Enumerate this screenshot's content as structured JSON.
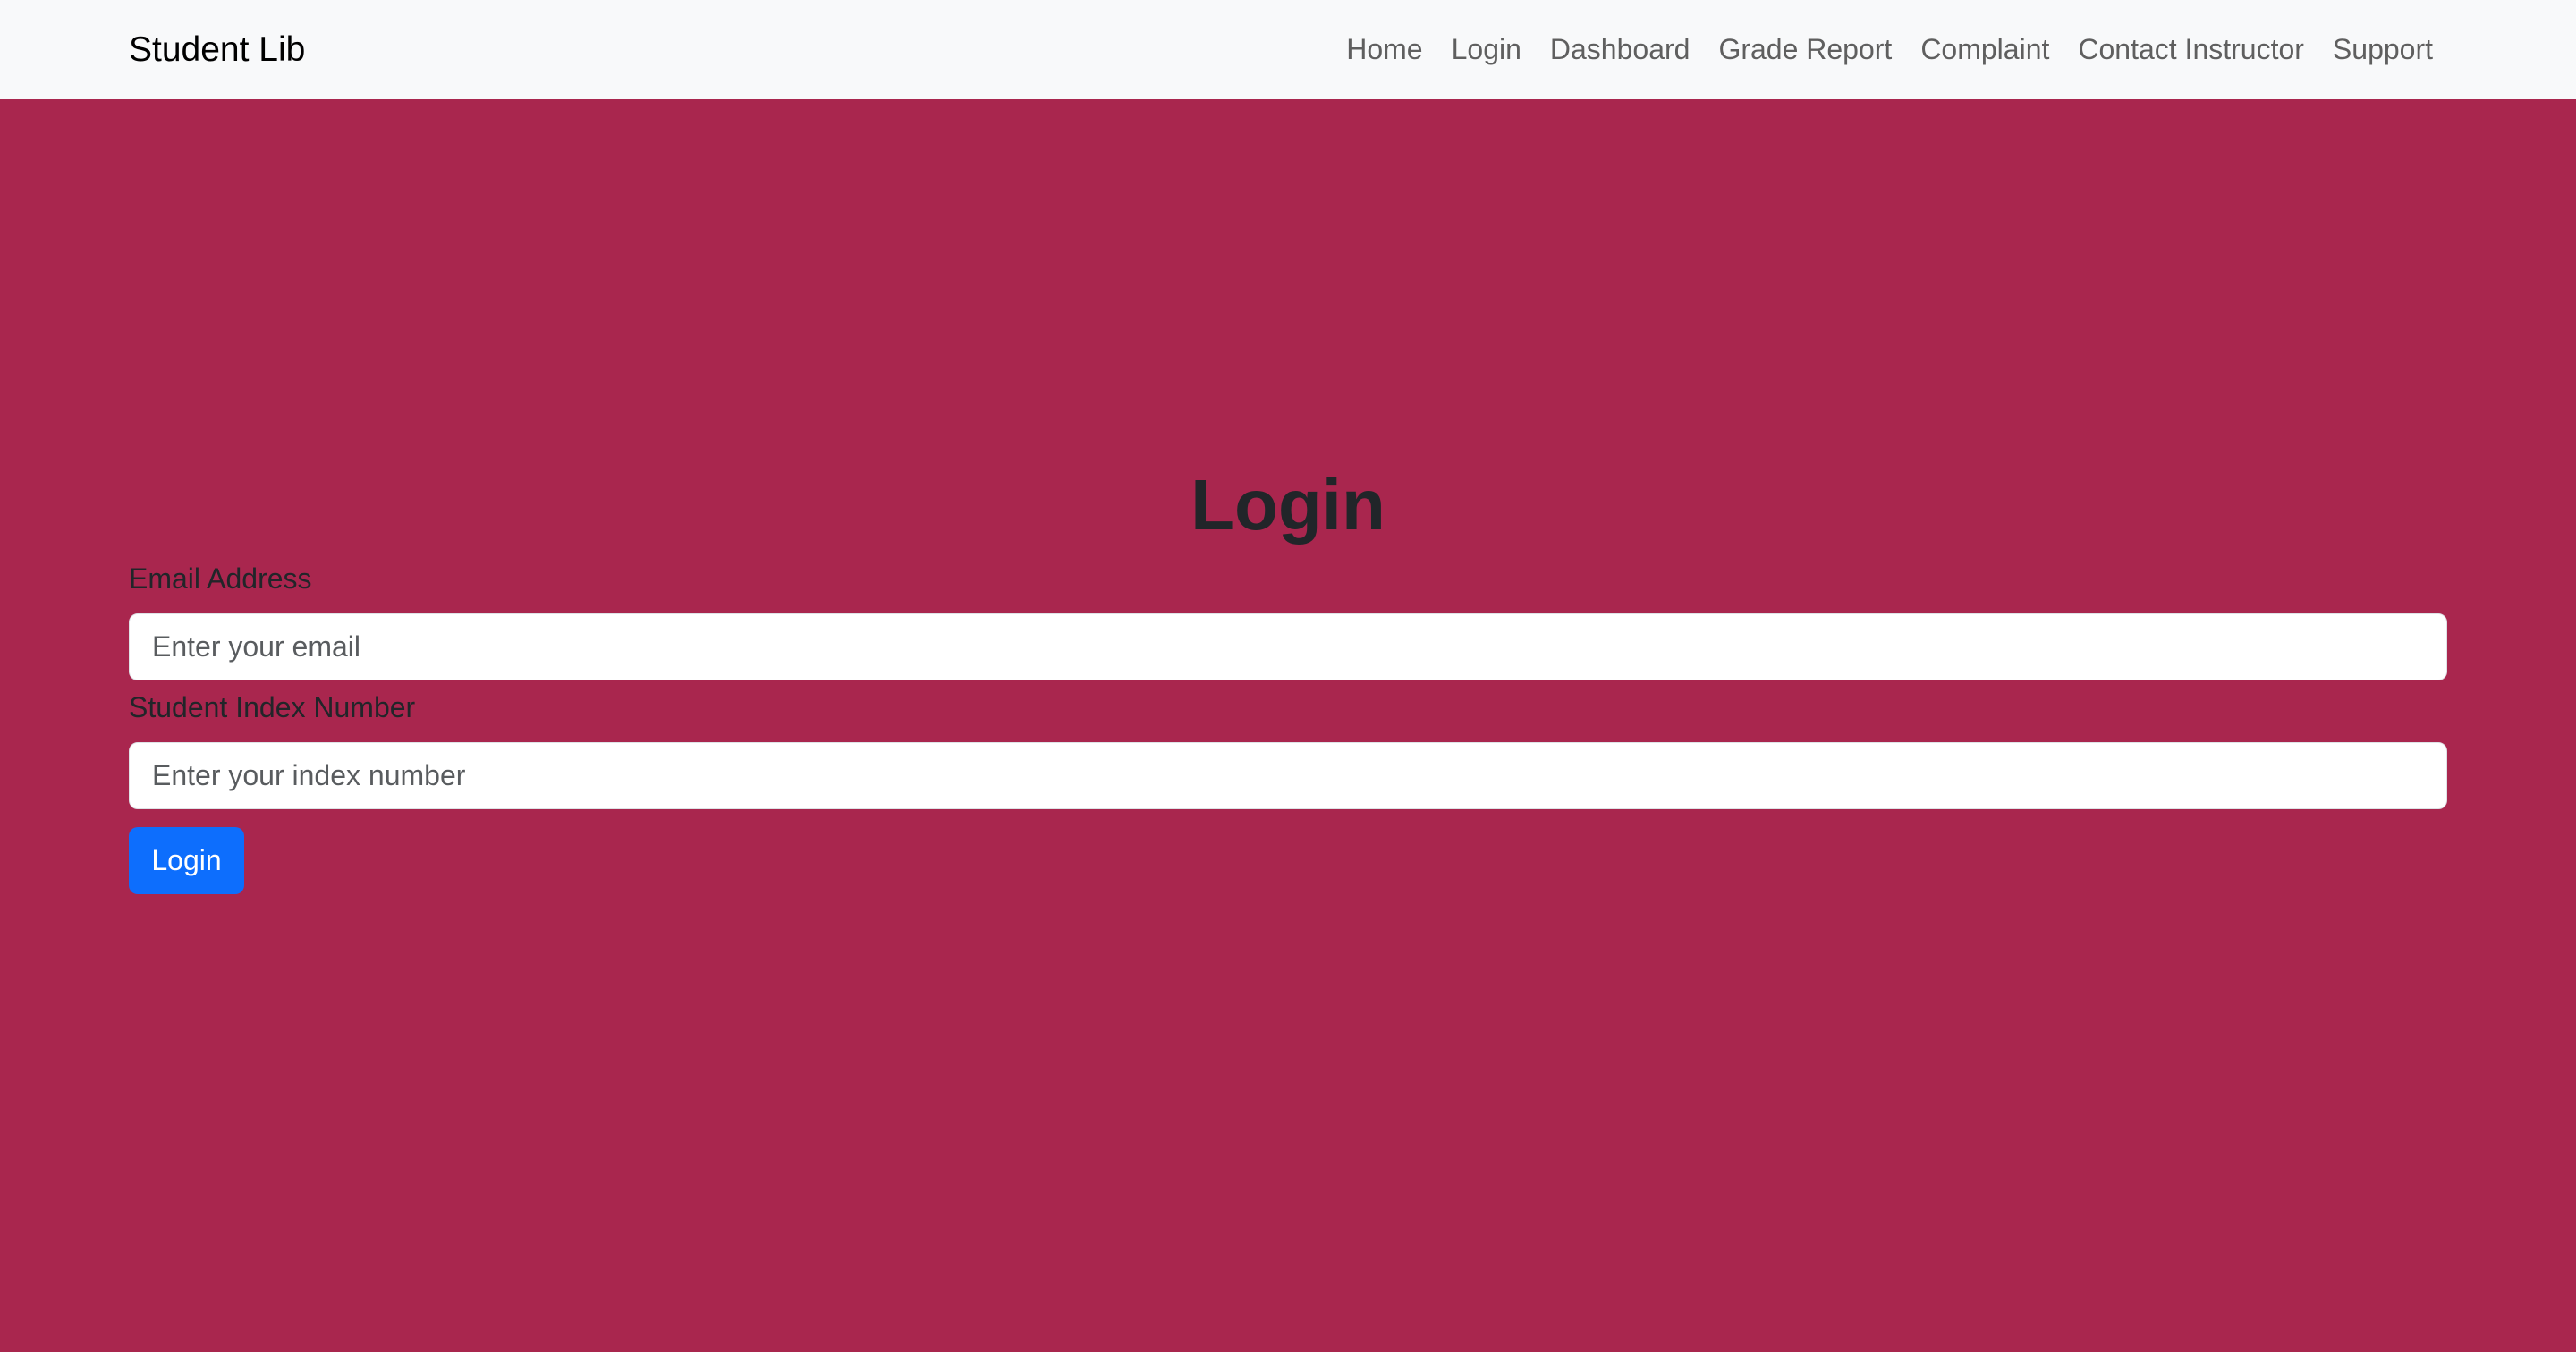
{
  "navbar": {
    "brand": "Student Lib",
    "links": [
      {
        "label": "Home"
      },
      {
        "label": "Login"
      },
      {
        "label": "Dashboard"
      },
      {
        "label": "Grade Report"
      },
      {
        "label": "Complaint"
      },
      {
        "label": "Contact Instructor"
      },
      {
        "label": "Support"
      }
    ]
  },
  "login_form": {
    "title": "Login",
    "email_label": "Email Address",
    "email_placeholder": "Enter your email",
    "email_value": "",
    "index_label": "Student Index Number",
    "index_placeholder": "Enter your index number",
    "index_value": "",
    "submit_label": "Login"
  },
  "colors": {
    "page_background": "#a9264e",
    "navbar_background": "#f8f9fa",
    "primary_button": "#0d6efd"
  }
}
